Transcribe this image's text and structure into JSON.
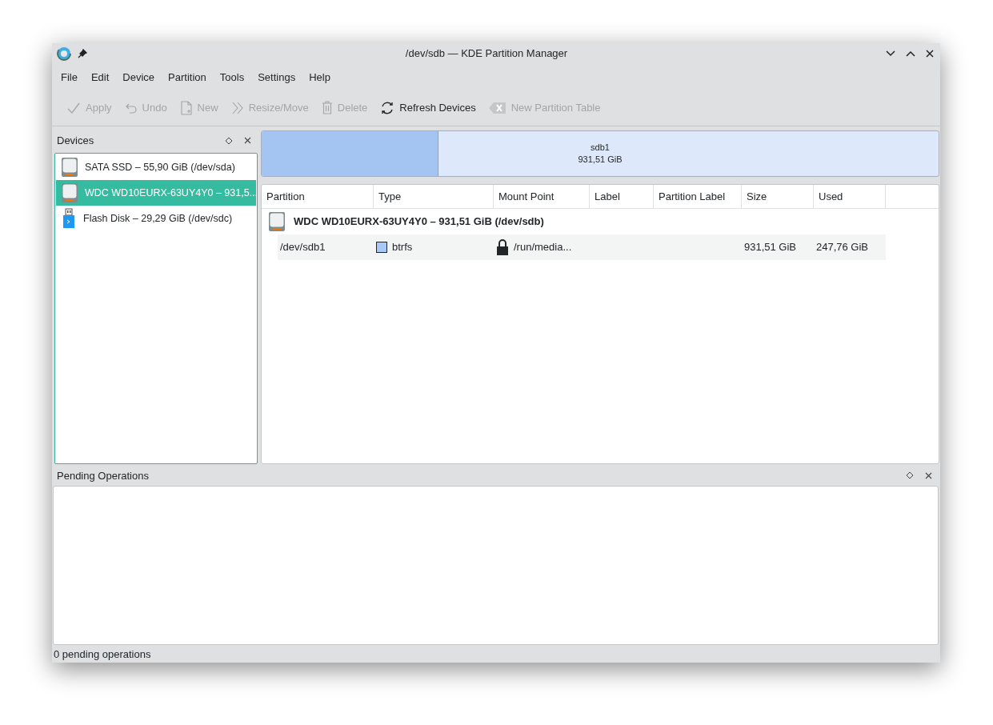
{
  "window": {
    "title": "/dev/sdb — KDE Partition Manager"
  },
  "menu": [
    "File",
    "Edit",
    "Device",
    "Partition",
    "Tools",
    "Settings",
    "Help"
  ],
  "toolbar": [
    {
      "label": "Apply",
      "kind": "check",
      "disabled": true
    },
    {
      "label": "Undo",
      "kind": "undo",
      "disabled": true
    },
    {
      "label": "New",
      "kind": "new",
      "disabled": true
    },
    {
      "label": "Resize/Move",
      "kind": "resize",
      "disabled": true
    },
    {
      "label": "Delete",
      "kind": "delete",
      "disabled": true
    },
    {
      "label": "Refresh Devices",
      "kind": "refresh",
      "disabled": false
    },
    {
      "label": "New Partition Table",
      "kind": "table",
      "disabled": true
    }
  ],
  "devices_panel": {
    "title": "Devices",
    "items": [
      {
        "label": "SATA SSD – 55,90 GiB (/dev/sda)",
        "kind": "hdd",
        "selected": false
      },
      {
        "label": "WDC WD10EURX-63UY4Y0 – 931,5...",
        "kind": "hdd",
        "selected": true
      },
      {
        "label": "Flash Disk – 29,29 GiB (/dev/sdc)",
        "kind": "usb",
        "selected": false
      }
    ]
  },
  "partition_bar": {
    "name": "sdb1",
    "size": "931,51 GiB",
    "level": 0.26
  },
  "table": {
    "columns": [
      "Partition",
      "Type",
      "Mount Point",
      "Label",
      "Partition Label",
      "Size",
      "Used"
    ],
    "device_row": {
      "label": "WDC WD10EURX-63UY4Y0 – 931,51 GiB (/dev/sdb)"
    },
    "rows": [
      {
        "partition": "/dev/sdb1",
        "type": "btrfs",
        "color": "#a8c8f8",
        "mount_point": "/run/media...",
        "size": "931,51 GiB",
        "used": "247,76 GiB"
      }
    ]
  },
  "pending_panel": {
    "title": "Pending Operations"
  },
  "status_bar": "0 pending operations"
}
